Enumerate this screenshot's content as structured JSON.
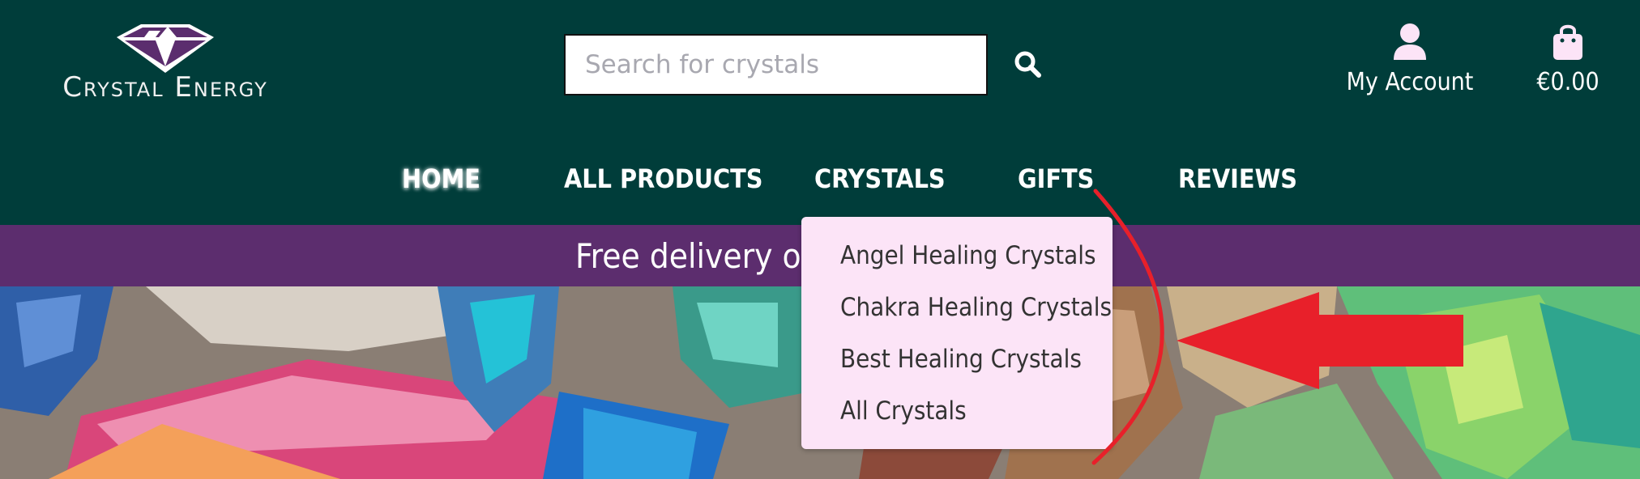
{
  "brand": {
    "name": "Crystal Energy"
  },
  "search": {
    "placeholder": "Search for crystals",
    "icon": "search-icon"
  },
  "account": {
    "label": "My Account",
    "icon": "user-icon"
  },
  "cart": {
    "total": "€0.00",
    "icon": "shopping-bag-icon"
  },
  "nav": {
    "items": [
      {
        "label": "HOME",
        "active": true
      },
      {
        "label": "ALL PRODUCTS"
      },
      {
        "label": "CRYSTALS"
      },
      {
        "label": "GIFTS"
      },
      {
        "label": "REVIEWS"
      }
    ]
  },
  "banner": {
    "text": "Free delivery on"
  },
  "dropdown": {
    "items": [
      {
        "label": "Angel Healing Crystals"
      },
      {
        "label": "Chakra Healing Crystals"
      },
      {
        "label": "Best Healing Crystals"
      },
      {
        "label": "All Crystals"
      }
    ]
  },
  "colors": {
    "header_bg": "#003d3a",
    "banner_bg": "#5c2d6e",
    "dropdown_bg": "#fce4f7",
    "annotation": "#e8202a",
    "logo_purple": "#5b2d6e",
    "icon_pink": "#fce4f7"
  }
}
